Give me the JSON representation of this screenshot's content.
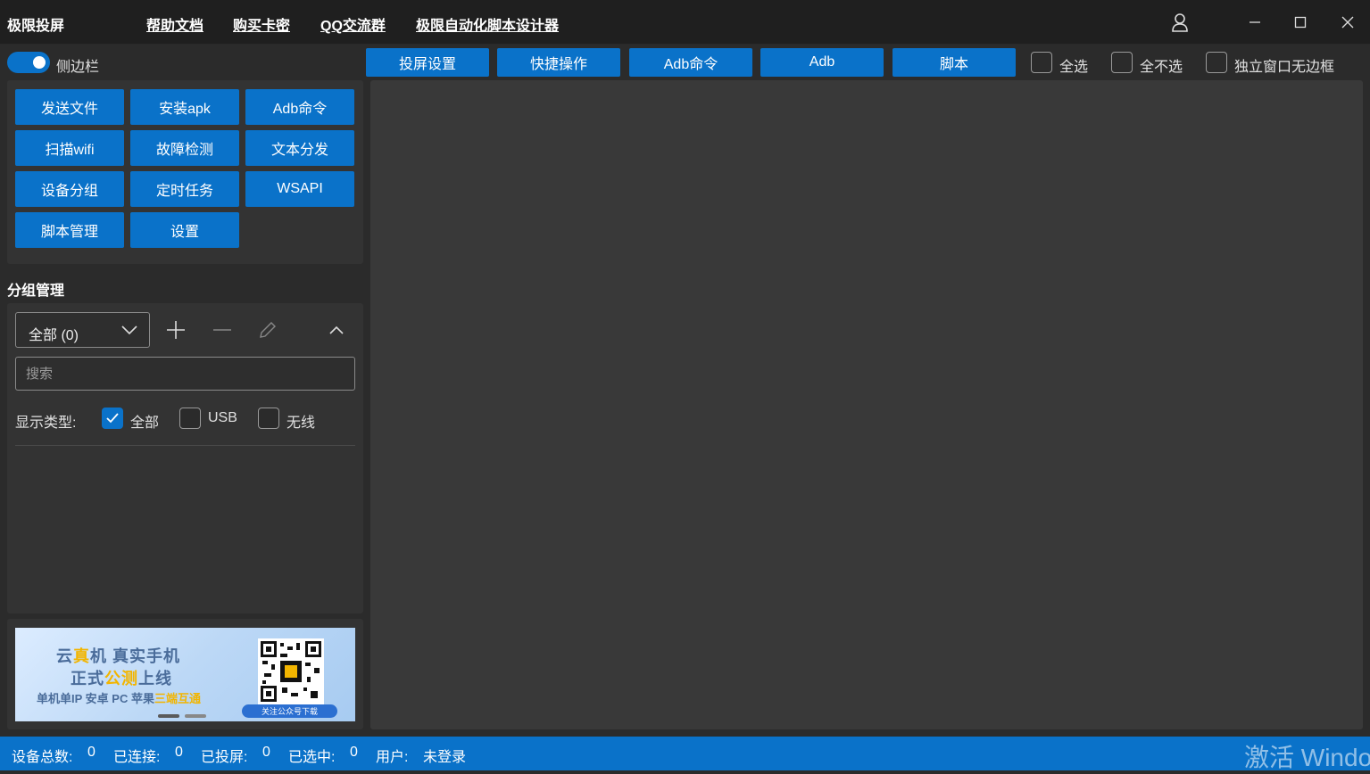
{
  "app": {
    "title": "极限投屏",
    "nav_links": [
      "帮助文档",
      "购买卡密",
      "QQ交流群",
      "极限自动化脚本设计器"
    ]
  },
  "toolbar": {
    "sidebar_toggle_label": "侧边栏",
    "sidebar_toggle_on": true,
    "tabs": [
      "投屏设置",
      "快捷操作",
      "Adb命令",
      "Adb",
      "脚本"
    ],
    "checkboxes": [
      {
        "label": "全选",
        "checked": false
      },
      {
        "label": "全不选",
        "checked": false
      },
      {
        "label": "独立窗口无边框",
        "checked": false
      }
    ]
  },
  "sidebar": {
    "buttons": [
      "发送文件",
      "安装apk",
      "Adb命令",
      "扫描wifi",
      "故障检测",
      "文本分发",
      "设备分组",
      "定时任务",
      "WSAPI",
      "脚本管理",
      "设置"
    ],
    "group_section_title": "分组管理",
    "group_select_value": "全部 (0)",
    "search_placeholder": "搜索",
    "display_type_label": "显示类型:",
    "display_types": [
      {
        "label": "全部",
        "checked": true
      },
      {
        "label": "USB",
        "checked": false
      },
      {
        "label": "无线",
        "checked": false
      }
    ],
    "banner": {
      "line1_a": "云",
      "line1_hl": "真",
      "line1_b": "机  真实手机",
      "line2_a": "正式",
      "line2_hl": "公测",
      "line2_b": "上线",
      "line3_a": "单机单IP 安卓 PC 苹果",
      "line3_hl": "三端互通",
      "qr_caption": "关注公众号下载"
    }
  },
  "status": {
    "total_label": "设备总数:",
    "total_value": "0",
    "connected_label": "已连接:",
    "connected_value": "0",
    "mirrored_label": "已投屏:",
    "mirrored_value": "0",
    "selected_label": "已选中:",
    "selected_value": "0",
    "user_label": "用户:",
    "user_value": "未登录"
  },
  "watermark": "激活 Windo",
  "colors": {
    "accent": "#0a72c9",
    "titlebar": "#1f1f1f",
    "background": "#2b2b2b",
    "panel": "#333333",
    "main_area": "#393939"
  }
}
